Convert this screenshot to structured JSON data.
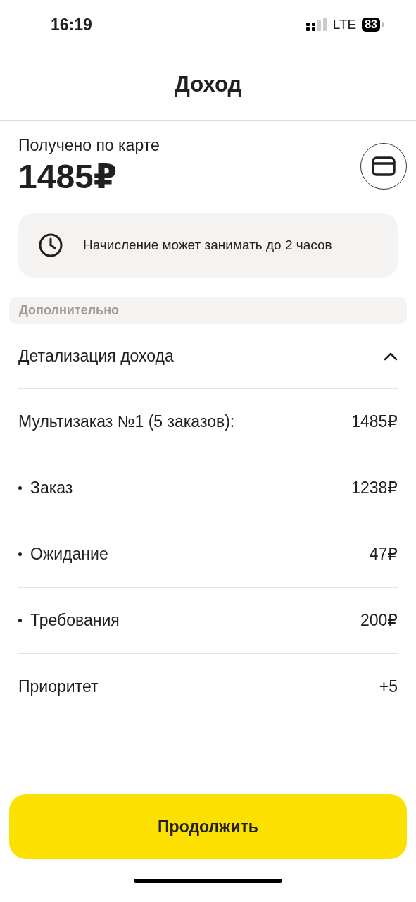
{
  "status_bar": {
    "time": "16:19",
    "network": "LTE",
    "battery": "83"
  },
  "header": {
    "title": "Доход"
  },
  "summary": {
    "label": "Получено по карте",
    "amount": "1485₽"
  },
  "notice": {
    "text": "Начисление может занимать до 2 часов"
  },
  "section": {
    "title": "Дополнительно"
  },
  "details": {
    "title": "Детализация дохода",
    "expanded": true,
    "rows": [
      {
        "kind": "total",
        "label": "Мультизаказ №1 (5 заказов):",
        "value": "1485₽"
      },
      {
        "kind": "item",
        "label": "Заказ",
        "value": "1238₽"
      },
      {
        "kind": "item",
        "label": "Ожидание",
        "value": "47₽"
      },
      {
        "kind": "item",
        "label": "Требования",
        "value": "200₽"
      },
      {
        "kind": "plain",
        "label": "Приоритет",
        "value": "+5"
      }
    ]
  },
  "button": {
    "label": "Продолжить"
  }
}
